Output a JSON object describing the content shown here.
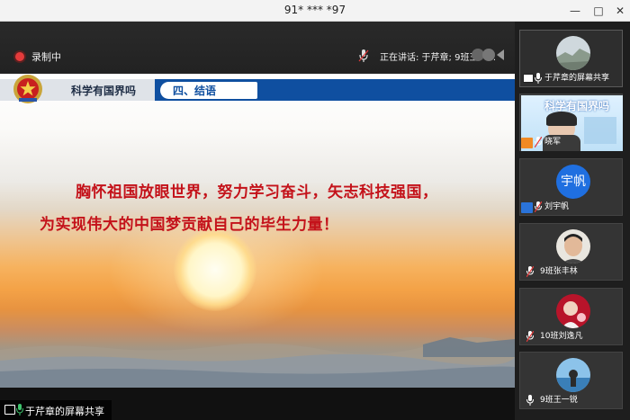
{
  "window": {
    "title": "91* *** *97",
    "controls": [
      "minimize",
      "maximize",
      "close"
    ]
  },
  "main": {
    "recording_label": "录制中",
    "speaking_label": "正在讲话: 于芹章; 9班王一...",
    "share_label": "于芹章的屏幕共享"
  },
  "slide": {
    "header_title": "科学有国界吗",
    "section_label": "四、结语",
    "slogan_line1": "胸怀祖国放眼世界，努力学习奋斗，矢志科技强国，",
    "slogan_line2": "为实现伟大的中国梦贡献自己的毕生力量！",
    "text_color": "#c4121a",
    "header_blue": "#0f4fa0"
  },
  "participants": [
    {
      "name": "于芹章的屏幕共享",
      "type": "screen-share"
    },
    {
      "name": "晓军",
      "type": "video",
      "video_title": "科学有国界吗"
    },
    {
      "name": "刘宇帆",
      "type": "initials",
      "initials": "宇帆"
    },
    {
      "name": "9班张丰林",
      "type": "photo"
    },
    {
      "name": "10班刘逸凡",
      "type": "photo"
    },
    {
      "name": "9班王一锐",
      "type": "photo"
    }
  ]
}
